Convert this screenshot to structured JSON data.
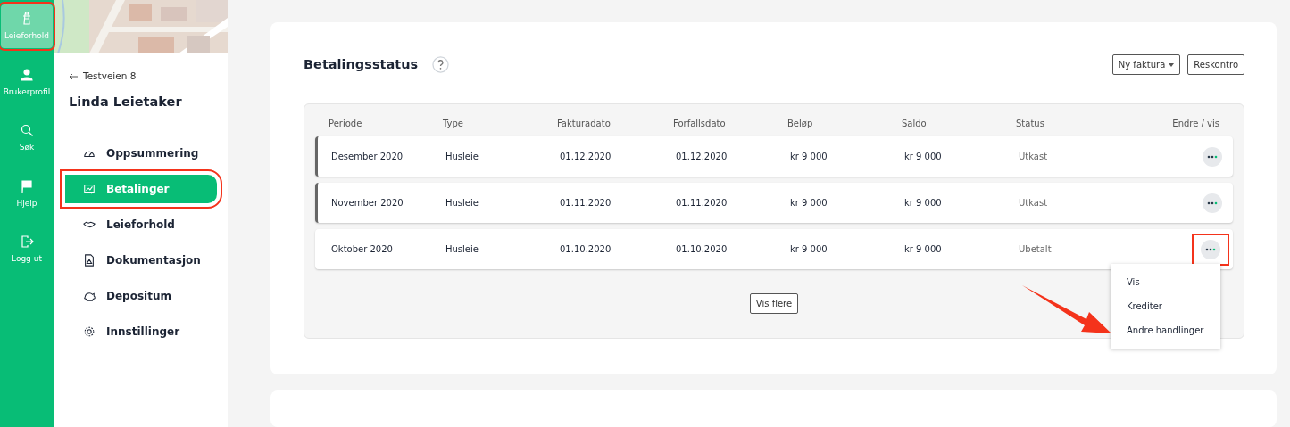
{
  "rail": [
    {
      "label": "Leieforhold",
      "selected": true,
      "highlighted": true
    },
    {
      "label": "Brukerprofil",
      "selected": false,
      "highlighted": false
    },
    {
      "label": "Søk",
      "selected": false,
      "highlighted": false
    },
    {
      "label": "Hjelp",
      "selected": false,
      "highlighted": false
    },
    {
      "label": "Logg ut",
      "selected": false,
      "highlighted": false
    }
  ],
  "sidebar": {
    "back_link": "Testveien 8",
    "title": "Linda Leietaker",
    "items": [
      {
        "label": "Oppsummering",
        "selected": false,
        "highlighted": false
      },
      {
        "label": "Betalinger",
        "selected": true,
        "highlighted": true
      },
      {
        "label": "Leieforhold",
        "selected": false,
        "highlighted": false
      },
      {
        "label": "Dokumentasjon",
        "selected": false,
        "highlighted": false
      },
      {
        "label": "Depositum",
        "selected": false,
        "highlighted": false
      },
      {
        "label": "Innstillinger",
        "selected": false,
        "highlighted": false
      }
    ]
  },
  "payment_status": {
    "title": "Betalingsstatus",
    "buttons": [
      {
        "label": "Ny faktura",
        "kind": "dropdown"
      },
      {
        "label": "Reskontro",
        "kind": "button"
      }
    ],
    "table": {
      "columns": [
        "Periode",
        "Type",
        "Fakturadato",
        "Forfallsdato",
        "Beløp",
        "Saldo",
        "Status",
        "Endre / vis"
      ],
      "rows": [
        {
          "cells": [
            "Desember 2020",
            "Husleie",
            "01.12.2020",
            "01.12.2020",
            "kr 9 000",
            "kr 9 000",
            "Utkast"
          ],
          "marked": true,
          "highlighted": false,
          "menu_open": false
        },
        {
          "cells": [
            "November 2020",
            "Husleie",
            "01.11.2020",
            "01.11.2020",
            "kr 9 000",
            "kr 9 000",
            "Utkast"
          ],
          "marked": true,
          "highlighted": false,
          "menu_open": false
        },
        {
          "cells": [
            "Oktober 2020",
            "Husleie",
            "01.10.2020",
            "01.10.2020",
            "kr 9 000",
            "kr 9 000",
            "Ubetalt"
          ],
          "marked": false,
          "highlighted": true,
          "menu_open": true
        }
      ]
    },
    "row_menu": [
      "Vis",
      "Krediter",
      "Andre handlinger"
    ],
    "show_more": "Vis flere"
  },
  "annotation_arrow": true
}
